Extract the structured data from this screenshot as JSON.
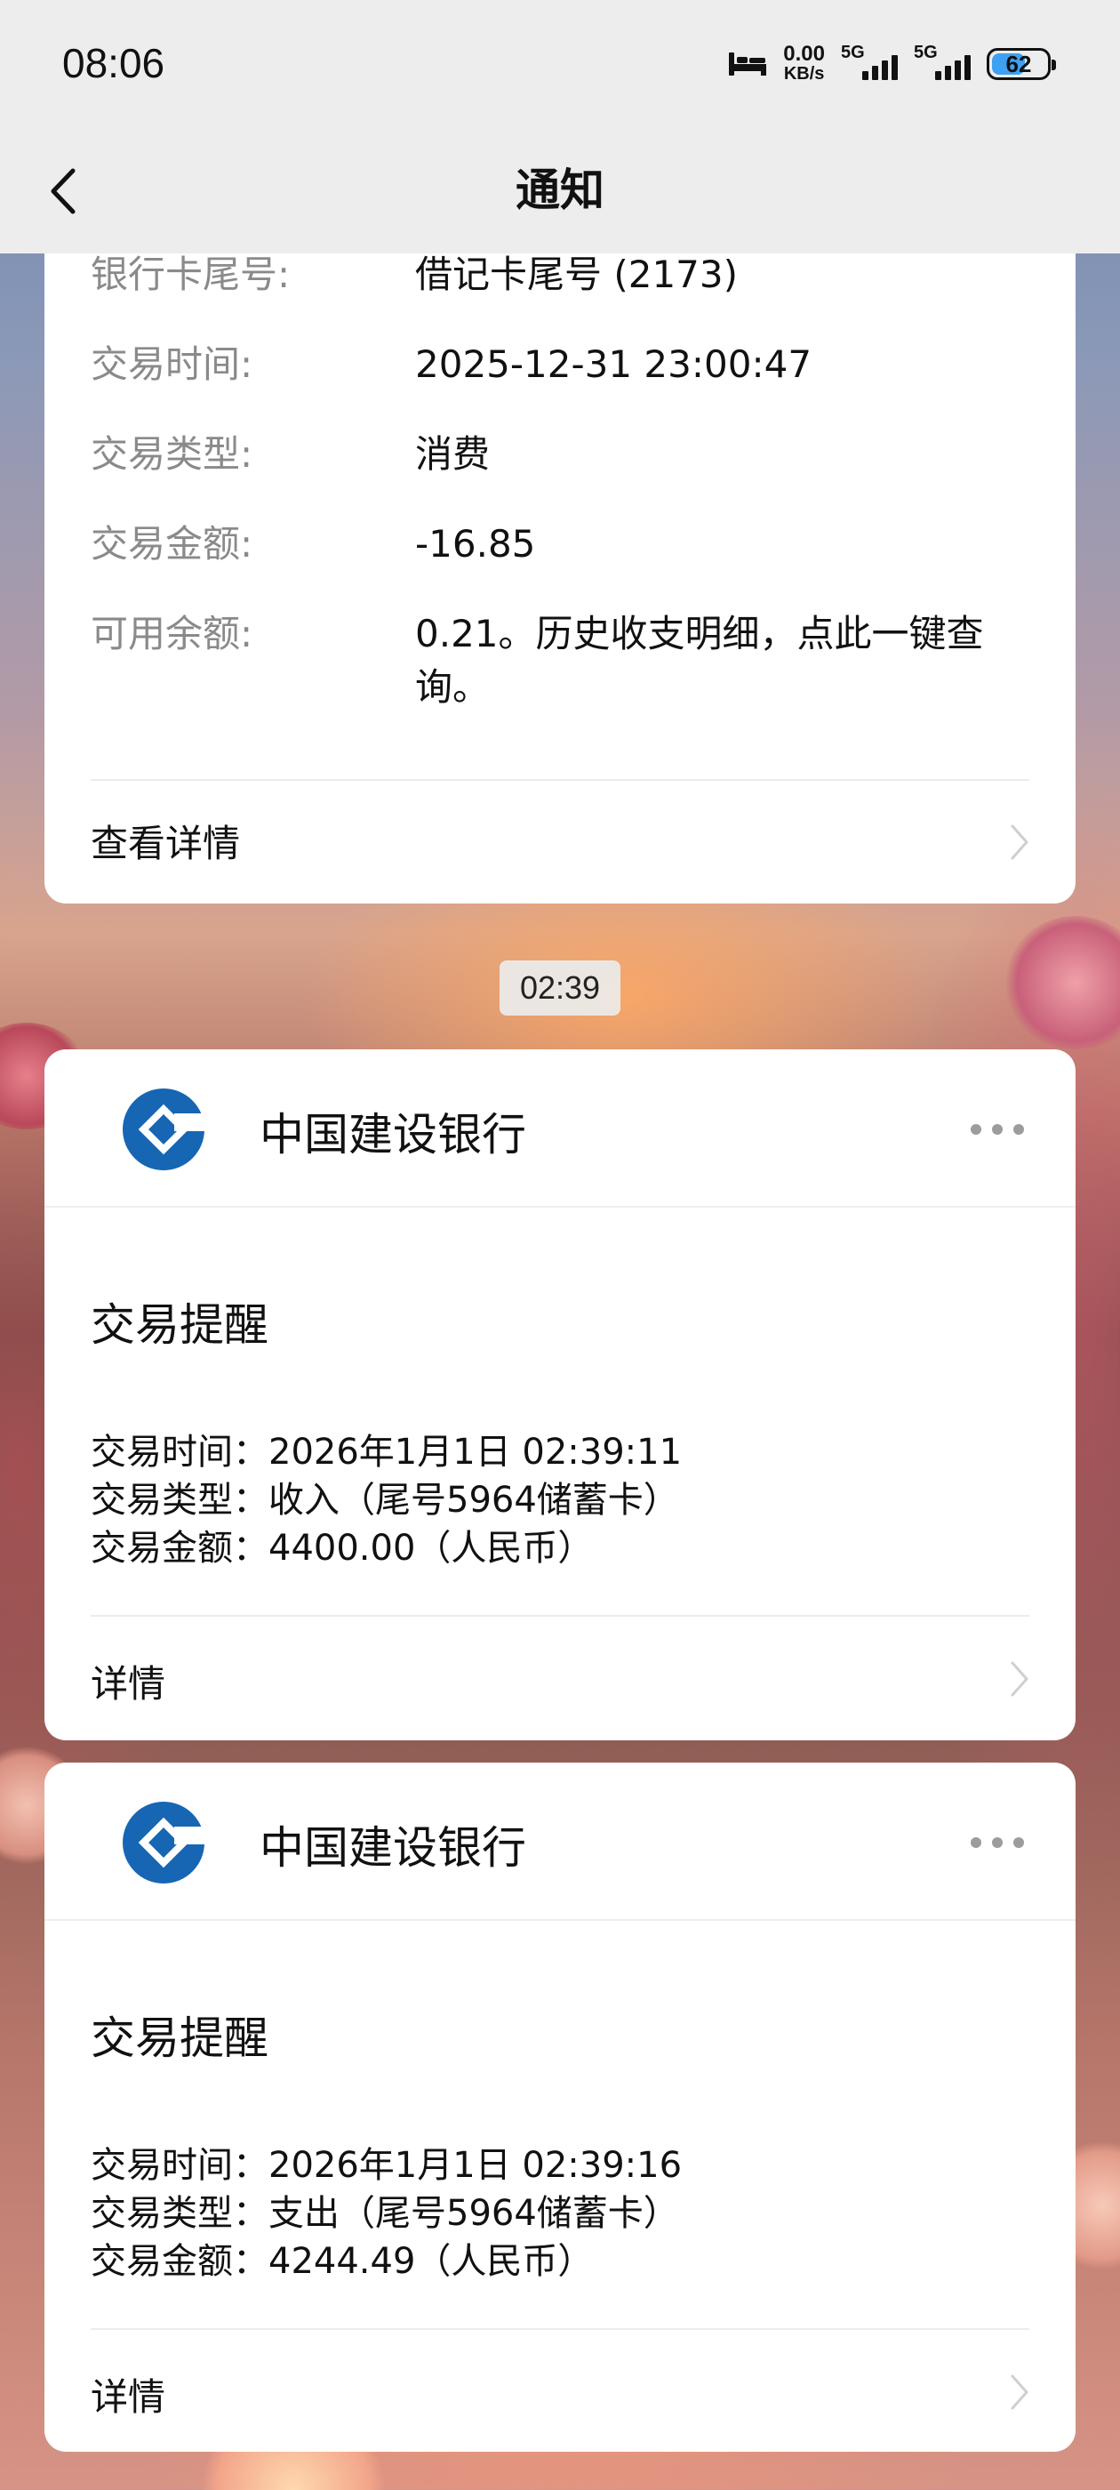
{
  "status_bar": {
    "time": "08:06",
    "net_speed_value": "0.00",
    "net_speed_unit": "KB/s",
    "sim1_label": "5G",
    "sim2_label": "5G",
    "battery_level": 62,
    "battery_text": "62",
    "battery_color": "#3ea0f2"
  },
  "nav": {
    "title": "通知"
  },
  "card1": {
    "rows": [
      {
        "key": "银行卡尾号:",
        "value": "借记卡尾号 (2173)"
      },
      {
        "key": "交易时间:",
        "value": "2025-12-31 23:00:47"
      },
      {
        "key": "交易类型:",
        "value": "消费"
      },
      {
        "key": "交易金额:",
        "value": "-16.85"
      },
      {
        "key": "可用余额:",
        "value": "0.21。历史收支明细，点此一键查询。"
      }
    ],
    "link_label": "查看详情"
  },
  "time_chip": "02:39",
  "card2": {
    "bank_name": "中国建设银行",
    "title": "交易提醒",
    "lines": [
      "交易时间：2026年1月1日 02:39:11",
      "交易类型：收入（尾号5964储蓄卡）",
      "交易金额：4400.00（人民币）"
    ],
    "link_label": "详情"
  },
  "card3": {
    "bank_name": "中国建设银行",
    "title": "交易提醒",
    "lines": [
      "交易时间：2026年1月1日 02:39:16",
      "交易类型：支出（尾号5964储蓄卡）",
      "交易金额：4244.49（人民币）"
    ],
    "link_label": "详情"
  },
  "colors": {
    "brand_blue": "#1666b3",
    "label_gray": "#8a8a8a",
    "bar_bg": "#ededed"
  },
  "icons": [
    "bed-icon",
    "back-icon",
    "bank-logo",
    "more-icon",
    "chevron-right-icon"
  ]
}
